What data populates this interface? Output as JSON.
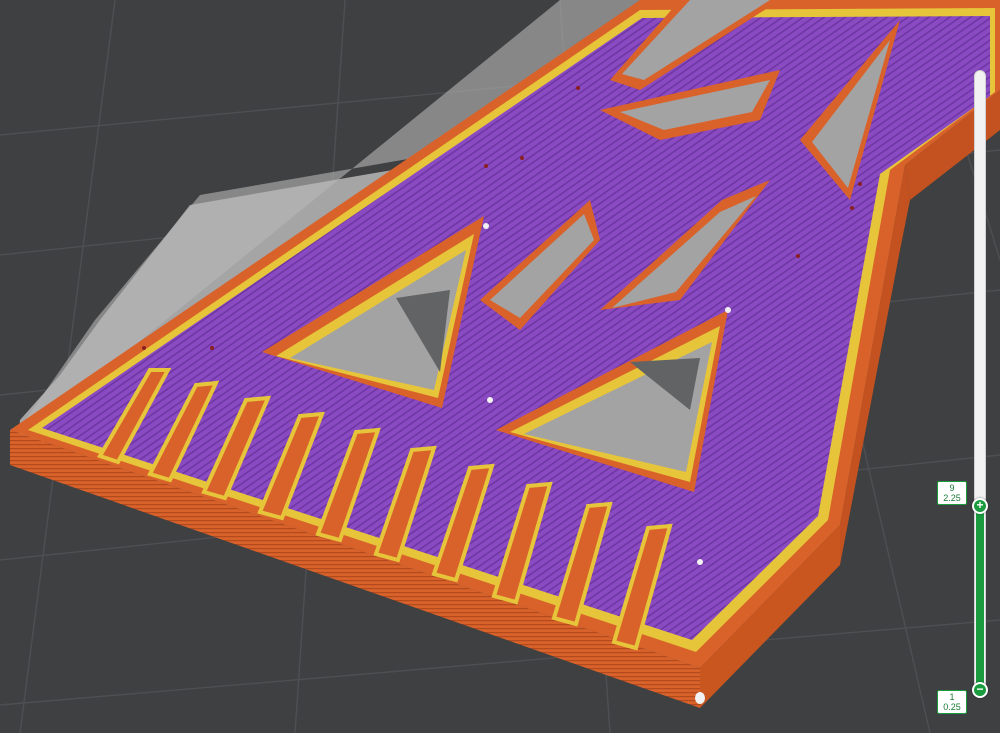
{
  "viewer": {
    "background_color": "#3f4042",
    "colors": {
      "ghost_model": "#a3a3a3",
      "perimeter_outer": "#d9622a",
      "perimeter_inner": "#e6c53a",
      "solid_infill": "#8a4bc2",
      "seam": "#8a1f22"
    }
  },
  "layer_slider": {
    "layer_min": 1,
    "layer_max": 9,
    "top_layer_number": "9",
    "top_layer_height": "2.25",
    "bottom_layer_number": "1",
    "bottom_layer_height": "0.25",
    "top_thumb_icon": "plus-icon",
    "bottom_thumb_icon": "minus-icon",
    "accent_color": "#1a9b3e"
  }
}
